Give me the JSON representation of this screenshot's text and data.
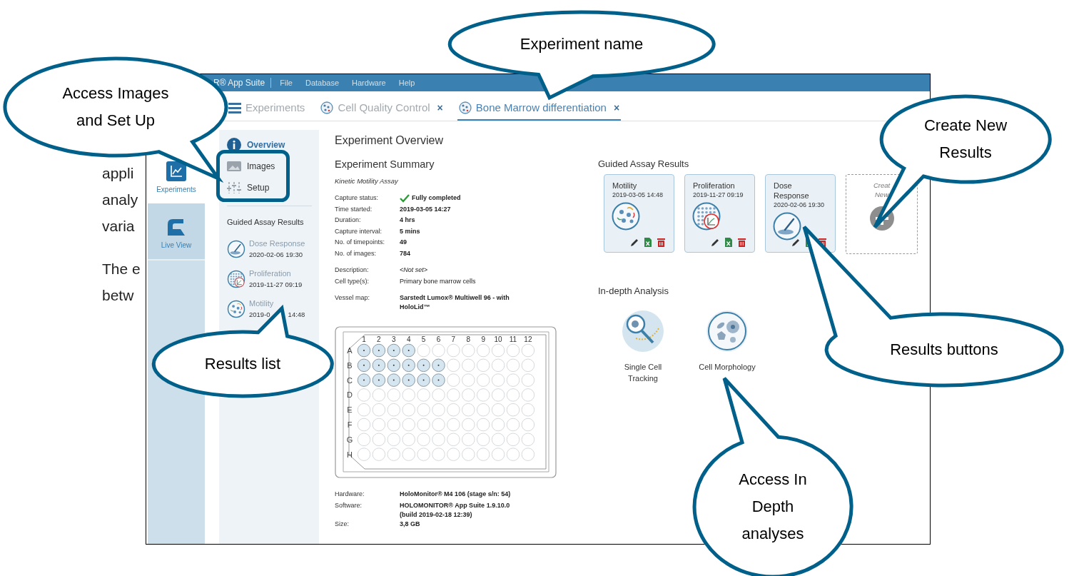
{
  "document_text": [
    "appli",
    "analy",
    "varia",
    "The e",
    "betw"
  ],
  "app": {
    "title_bar": {
      "app_name": "R® App Suite",
      "menu": [
        "File",
        "Database",
        "Hardware",
        "Help"
      ]
    },
    "tabs": [
      {
        "label": "Experiments",
        "kind": "home",
        "selected": false
      },
      {
        "label": "Cell Quality Control",
        "kind": "experiment",
        "selected": false,
        "close": "×"
      },
      {
        "label": "Bone Marrow differentiation",
        "kind": "experiment",
        "selected": true,
        "close": "×"
      }
    ],
    "nav_rail": [
      {
        "label": "Experiments",
        "kind": "experiments",
        "selected": true
      },
      {
        "label": "Live View",
        "kind": "live",
        "selected": false
      }
    ],
    "sidebar": {
      "items": [
        {
          "label": "Overview",
          "kind": "overview",
          "selected": true
        },
        {
          "label": "Images",
          "kind": "images",
          "selected": false
        },
        {
          "label": "Setup",
          "kind": "setup",
          "selected": false
        }
      ],
      "results_heading": "Guided Assay Results",
      "results": [
        {
          "kind": "dose",
          "name": "Dose Response",
          "date": "2020-02-06 19:30"
        },
        {
          "kind": "proliferation",
          "name": "Proliferation",
          "date": "2019-11-27 09:19"
        },
        {
          "kind": "motility",
          "name": "Motility",
          "date": "2019-0",
          "date_end": "14:48"
        }
      ]
    },
    "overview": {
      "title": "Experiment Overview",
      "summary_heading": "Experiment Summary",
      "assay": "Kinetic Motility Assay",
      "field_groups": [
        [
          {
            "label": "Capture status:",
            "value": "Fully completed",
            "kind": "status"
          },
          {
            "label": "Time started:",
            "value": "2019-03-05 14:27",
            "kind": "bold"
          },
          {
            "label": "Duration:",
            "value": "4 hrs",
            "kind": "bold"
          },
          {
            "label": "Capture interval:",
            "value": "5 mins",
            "kind": "bold"
          },
          {
            "label": "No. of timepoints:",
            "value": "49",
            "kind": "bold"
          },
          {
            "label": "No. of images:",
            "value": "784",
            "kind": "bold"
          }
        ],
        [
          {
            "label": "Description:",
            "value": "<Not set>",
            "kind": "italic"
          },
          {
            "label": "Cell type(s):",
            "value": "Primary bone marrow cells",
            "kind": "plain"
          }
        ],
        [
          {
            "label": "Vessel map:",
            "value": "Sarstedt Lumox® Multiwell 96 - with HoloLid™",
            "kind": "bold"
          }
        ]
      ],
      "plate": {
        "columns": [
          "1",
          "2",
          "3",
          "4",
          "5",
          "6",
          "7",
          "8",
          "9",
          "10",
          "11",
          "12"
        ],
        "rows": [
          {
            "label": "A",
            "wells": [
              true,
              true,
              true,
              true,
              false,
              false,
              false,
              false,
              false,
              false,
              false,
              false
            ]
          },
          {
            "label": "B",
            "wells": [
              true,
              true,
              true,
              true,
              true,
              true,
              false,
              false,
              false,
              false,
              false,
              false
            ]
          },
          {
            "label": "C",
            "wells": [
              true,
              true,
              true,
              true,
              true,
              true,
              false,
              false,
              false,
              false,
              false,
              false
            ]
          },
          {
            "label": "D",
            "wells": [
              false,
              false,
              false,
              false,
              false,
              false,
              false,
              false,
              false,
              false,
              false,
              false
            ]
          },
          {
            "label": "E",
            "wells": [
              false,
              false,
              false,
              false,
              false,
              false,
              false,
              false,
              false,
              false,
              false,
              false
            ]
          },
          {
            "label": "F",
            "wells": [
              false,
              false,
              false,
              false,
              false,
              false,
              false,
              false,
              false,
              false,
              false,
              false
            ]
          },
          {
            "label": "G",
            "wells": [
              false,
              false,
              false,
              false,
              false,
              false,
              false,
              false,
              false,
              false,
              false,
              false
            ]
          },
          {
            "label": "H",
            "wells": [
              false,
              false,
              false,
              false,
              false,
              false,
              false,
              false,
              false,
              false,
              false,
              false
            ]
          }
        ]
      },
      "hardware_fields": [
        {
          "label": "Hardware:",
          "value": "HoloMonitor® M4 106 (stage s/n: 54)",
          "kind": "bold"
        },
        {
          "label": "Software:",
          "value": "HOLOMONITOR® App Suite 1.9.10.0 (build 2019-02-18 12:39)",
          "kind": "bold"
        },
        {
          "label": "Size:",
          "value": "3,8 GB",
          "kind": "bold"
        }
      ],
      "guided_heading": "Guided Assay Results",
      "cards": [
        {
          "kind": "motility",
          "name": "Motility",
          "date": "2019-03-05 14:48"
        },
        {
          "kind": "proliferation",
          "name": "Proliferation",
          "date": "2019-11-27 09:19"
        },
        {
          "kind": "dose",
          "name": "Dose Response",
          "date": "2020-02-06 19:30"
        },
        {
          "kind": "create",
          "lines": [
            "Creat",
            "New"
          ]
        }
      ],
      "in_depth_heading": "In-depth Analysis",
      "in_depth": [
        {
          "kind": "tracking",
          "label": "Single Cell Tracking"
        },
        {
          "kind": "morphology",
          "label": "Cell Morphology"
        }
      ]
    }
  },
  "callouts": [
    {
      "lines": [
        "Experiment name"
      ]
    },
    {
      "lines": [
        "Access Images",
        "and Set Up"
      ]
    },
    {
      "lines": [
        "Create New",
        "Results"
      ]
    },
    {
      "lines": [
        "Results buttons"
      ]
    },
    {
      "lines": [
        "Results list"
      ]
    },
    {
      "lines": [
        "Access In",
        "Depth",
        "analyses"
      ]
    }
  ]
}
